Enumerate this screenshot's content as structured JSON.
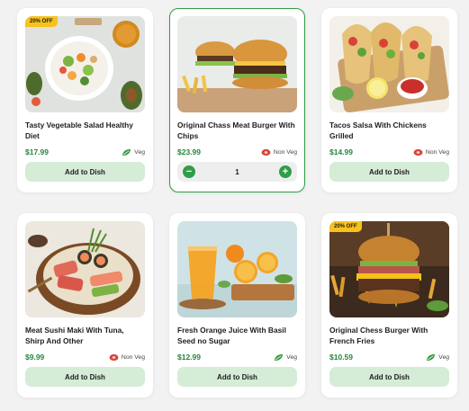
{
  "diet_labels": {
    "veg": "Veg",
    "nonveg": "Non Veg"
  },
  "actions": {
    "add_label": "Add to Dish"
  },
  "colors": {
    "accent": "#2e9e48",
    "price": "#27863c",
    "badge": "#f7c21c",
    "button_bg": "#d5ecd7",
    "nonveg": "#d6453a"
  },
  "items": [
    {
      "title": "Tasty Vegetable Salad Healthy Diet",
      "price": "$17.99",
      "diet": "Veg",
      "diet_icon": "leaf-icon",
      "badge": "20% OFF"
    },
    {
      "title": "Original Chass Meat Burger With Chips",
      "price": "$23.99",
      "diet": "Non Veg",
      "diet_icon": "meat-icon",
      "quantity": "1",
      "selected": true
    },
    {
      "title": "Tacos Salsa With Chickens Grilled",
      "price": "$14.99",
      "diet": "Non Veg",
      "diet_icon": "meat-icon"
    },
    {
      "title": "Meat Sushi Maki With Tuna, Shirp And Other",
      "price": "$9.99",
      "diet": "Non Veg",
      "diet_icon": "meat-icon"
    },
    {
      "title": "Fresh Orange Juice With Basil Seed no Sugar",
      "price": "$12.99",
      "diet": "Veg",
      "diet_icon": "leaf-icon"
    },
    {
      "title": "Original Chess Burger With French Fries",
      "price": "$10.59",
      "diet": "Veg",
      "diet_icon": "leaf-icon",
      "badge": "20% OFF"
    }
  ]
}
